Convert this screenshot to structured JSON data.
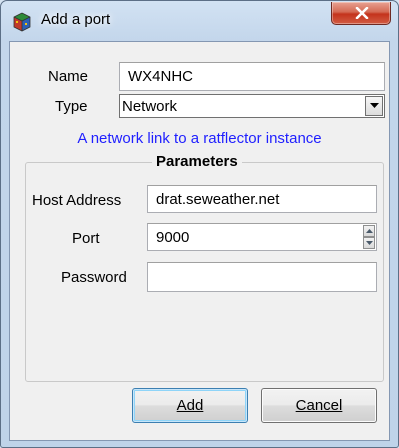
{
  "window": {
    "title": "Add a port",
    "app_icon": "ratflector-app-icon",
    "close_icon": "close-icon"
  },
  "form": {
    "name_label": "Name",
    "name_value": "WX4NHC",
    "type_label": "Type",
    "type_value": "Network",
    "type_description": "A network link to a ratflector instance"
  },
  "parameters": {
    "title": "Parameters",
    "host_label": "Host Address",
    "host_value": "drat.seweather.net",
    "port_label": "Port",
    "port_value": "9000",
    "password_label": "Password",
    "password_value": ""
  },
  "buttons": {
    "add": "Add",
    "cancel": "Cancel"
  },
  "colors": {
    "description_text": "#1f1fff",
    "close_button": "#c4331c"
  }
}
